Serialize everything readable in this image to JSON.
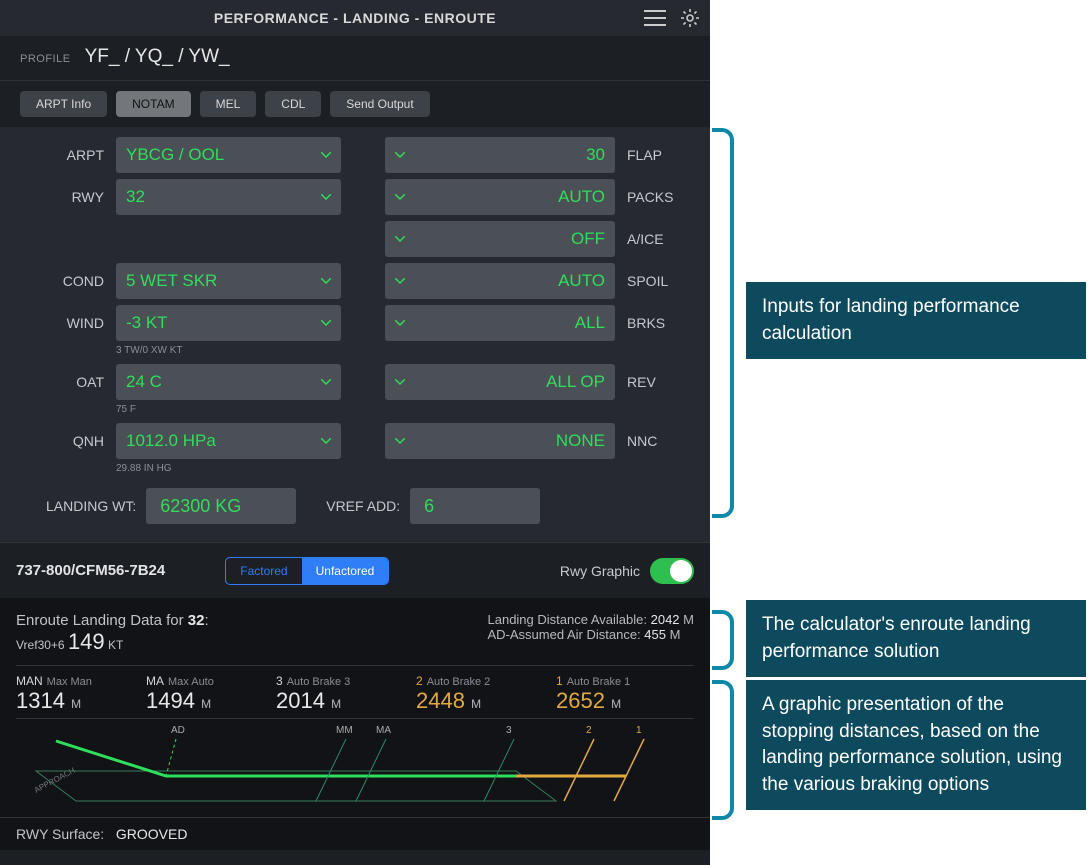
{
  "header": {
    "title": "PERFORMANCE - LANDING - ENROUTE"
  },
  "profile": {
    "label": "PROFILE",
    "value": "YF_ / YQ_ / YW_"
  },
  "tabs": {
    "arpt_info": "ARPT Info",
    "notam": "NOTAM",
    "mel": "MEL",
    "cdl": "CDL",
    "send_output": "Send Output"
  },
  "inputs": {
    "arpt_label": "ARPT",
    "arpt_value": "YBCG / OOL",
    "flap_label": "FLAP",
    "flap_value": "30",
    "rwy_label": "RWY",
    "rwy_value": "32",
    "packs_label": "PACKS",
    "packs_value": "AUTO",
    "aice_label": "A/ICE",
    "aice_value": "OFF",
    "cond_label": "COND",
    "cond_value": "5 WET SKR",
    "spoil_label": "SPOIL",
    "spoil_value": "AUTO",
    "wind_label": "WIND",
    "wind_value": "-3 KT",
    "wind_sub": "3 TW/0 XW KT",
    "brks_label": "BRKS",
    "brks_value": "ALL",
    "oat_label": "OAT",
    "oat_value": "24 C",
    "oat_sub": "75 F",
    "rev_label": "REV",
    "rev_value": "ALL OP",
    "qnh_label": "QNH",
    "qnh_value": "1012.0 HPa",
    "qnh_sub": "29.88 IN HG",
    "nnc_label": "NNC",
    "nnc_value": "NONE",
    "landing_wt_label": "LANDING WT:",
    "landing_wt_value": "62300 KG",
    "vref_add_label": "VREF ADD:",
    "vref_add_value": "6"
  },
  "midbar": {
    "aircraft": "737-800/CFM56-7B24",
    "factored": "Factored",
    "unfactored": "Unfactored",
    "rwy_graphic": "Rwy Graphic"
  },
  "results": {
    "title_prefix": "Enroute Landing Data for ",
    "title_rwy": "32",
    "title_colon": ":",
    "vref_label": "Vref30+6",
    "vref_value": "149",
    "vref_unit": "KT",
    "lda_label": "Landing Distance Available: ",
    "lda_value": "2042",
    "lda_unit": "M",
    "ad_label": "AD-Assumed Air Distance: ",
    "ad_value": "455",
    "ad_unit": "M"
  },
  "brakes": {
    "man": {
      "code": "MAN",
      "sub": "Max Man",
      "dist": "1314",
      "unit": "M"
    },
    "ma": {
      "code": "MA",
      "sub": "Max Auto",
      "dist": "1494",
      "unit": "M"
    },
    "ab3": {
      "code": "3",
      "sub": "Auto Brake 3",
      "dist": "2014",
      "unit": "M"
    },
    "ab2": {
      "code": "2",
      "sub": "Auto Brake 2",
      "dist": "2448",
      "unit": "M"
    },
    "ab1": {
      "code": "1",
      "sub": "Auto Brake 1",
      "dist": "2652",
      "unit": "M"
    }
  },
  "graphic_ticks": {
    "ad": "AD",
    "mm": "MM",
    "ma": "MA",
    "t3": "3",
    "t2": "2",
    "t1": "1",
    "approach": "APPROACH"
  },
  "surface": {
    "label": "RWY Surface:",
    "value": "GROOVED"
  },
  "annotations": {
    "inputs": "Inputs for landing performance calculation",
    "solution": "The calculator's enroute landing performance solution",
    "graphic": "A graphic presentation of the stopping distances, based on the landing performance solution, using the various braking options"
  }
}
